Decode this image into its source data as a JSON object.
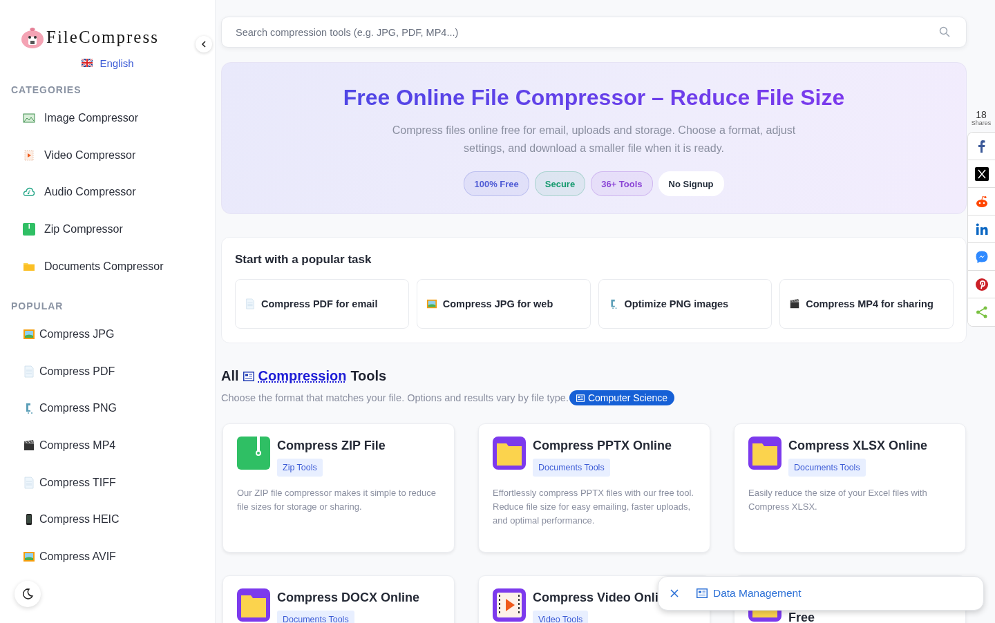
{
  "sidebar": {
    "logo": "FileCompress",
    "language": "English",
    "sections": [
      {
        "heading": "CATEGORIES",
        "items": [
          {
            "label": "Image Compressor",
            "kind": "landscape"
          },
          {
            "label": "Video Compressor",
            "kind": "video"
          },
          {
            "label": "Audio Compressor",
            "kind": "cloud"
          },
          {
            "label": "Zip Compressor",
            "kind": "zip"
          },
          {
            "label": "Documents Compressor",
            "kind": "folder"
          }
        ]
      },
      {
        "heading": "POPULAR",
        "items": [
          {
            "label": "Compress JPG",
            "kind": "picture"
          },
          {
            "label": "Compress PDF",
            "kind": "page"
          },
          {
            "label": "Compress PNG",
            "kind": "clamp"
          },
          {
            "label": "Compress MP4",
            "kind": "clapper"
          },
          {
            "label": "Compress TIFF",
            "kind": "page"
          },
          {
            "label": "Compress HEIC",
            "kind": "phone"
          },
          {
            "label": "Compress AVIF",
            "kind": "picture"
          }
        ]
      }
    ]
  },
  "search": {
    "placeholder": "Search compression tools (e.g. JPG, PDF, MP4...)"
  },
  "hero": {
    "title": "Free Online File Compressor – Reduce File Size",
    "subtitle": "Compress files online free for email, uploads and storage. Choose a format, adjust settings, and download a smaller file when it is ready.",
    "badges": [
      {
        "label": "100% Free",
        "color": "#4f5bd5"
      },
      {
        "label": "Secure",
        "color": "#159a6e"
      },
      {
        "label": "36+ Tools",
        "color": "#8b45d6"
      },
      {
        "label": "No Signup",
        "color": "#1f2937"
      }
    ]
  },
  "popular_tasks": {
    "title": "Start with a popular task",
    "tasks": [
      {
        "label": "Compress PDF for email",
        "kind": "page"
      },
      {
        "label": "Compress JPG for web",
        "kind": "picture"
      },
      {
        "label": "Optimize PNG images",
        "kind": "clamp"
      },
      {
        "label": "Compress MP4 for sharing",
        "kind": "clapper"
      }
    ]
  },
  "tools": {
    "heading_start": "All",
    "heading_link": "Compression",
    "heading_end": "Tools",
    "subtitle": "Choose the format that matches your file. Options and results vary by file type.",
    "chip": "Computer Science",
    "cards": [
      {
        "title": "Compress ZIP File",
        "tag": "Zip Tools",
        "description": "Our ZIP file compressor makes it simple to reduce file sizes for storage or sharing.",
        "kind": "zip"
      },
      {
        "title": "Compress PPTX Online",
        "tag": "Documents Tools",
        "description": "Effortlessly compress PPTX files with our free tool. Reduce file size for easy emailing, faster uploads, and optimal performance.",
        "kind": "folder"
      },
      {
        "title": "Compress XLSX Online",
        "tag": "Documents Tools",
        "description": "Easily reduce the size of your Excel files with Compress XLSX.",
        "kind": "folder"
      },
      {
        "title": "Compress DOCX Online",
        "tag": "Documents Tools",
        "kind": "folder"
      },
      {
        "title": "Compress Video Onli",
        "tag": "Video Tools",
        "kind": "video"
      },
      {
        "title": "Free",
        "kind": "folder"
      }
    ]
  },
  "share": {
    "count": "18",
    "label": "Shares",
    "buttons": [
      {
        "kind": "facebook"
      },
      {
        "kind": "x"
      },
      {
        "kind": "reddit"
      },
      {
        "kind": "linkedin"
      },
      {
        "kind": "messenger"
      },
      {
        "kind": "pinterest"
      },
      {
        "kind": "share"
      }
    ]
  },
  "popup": {
    "label": "Data Management"
  }
}
